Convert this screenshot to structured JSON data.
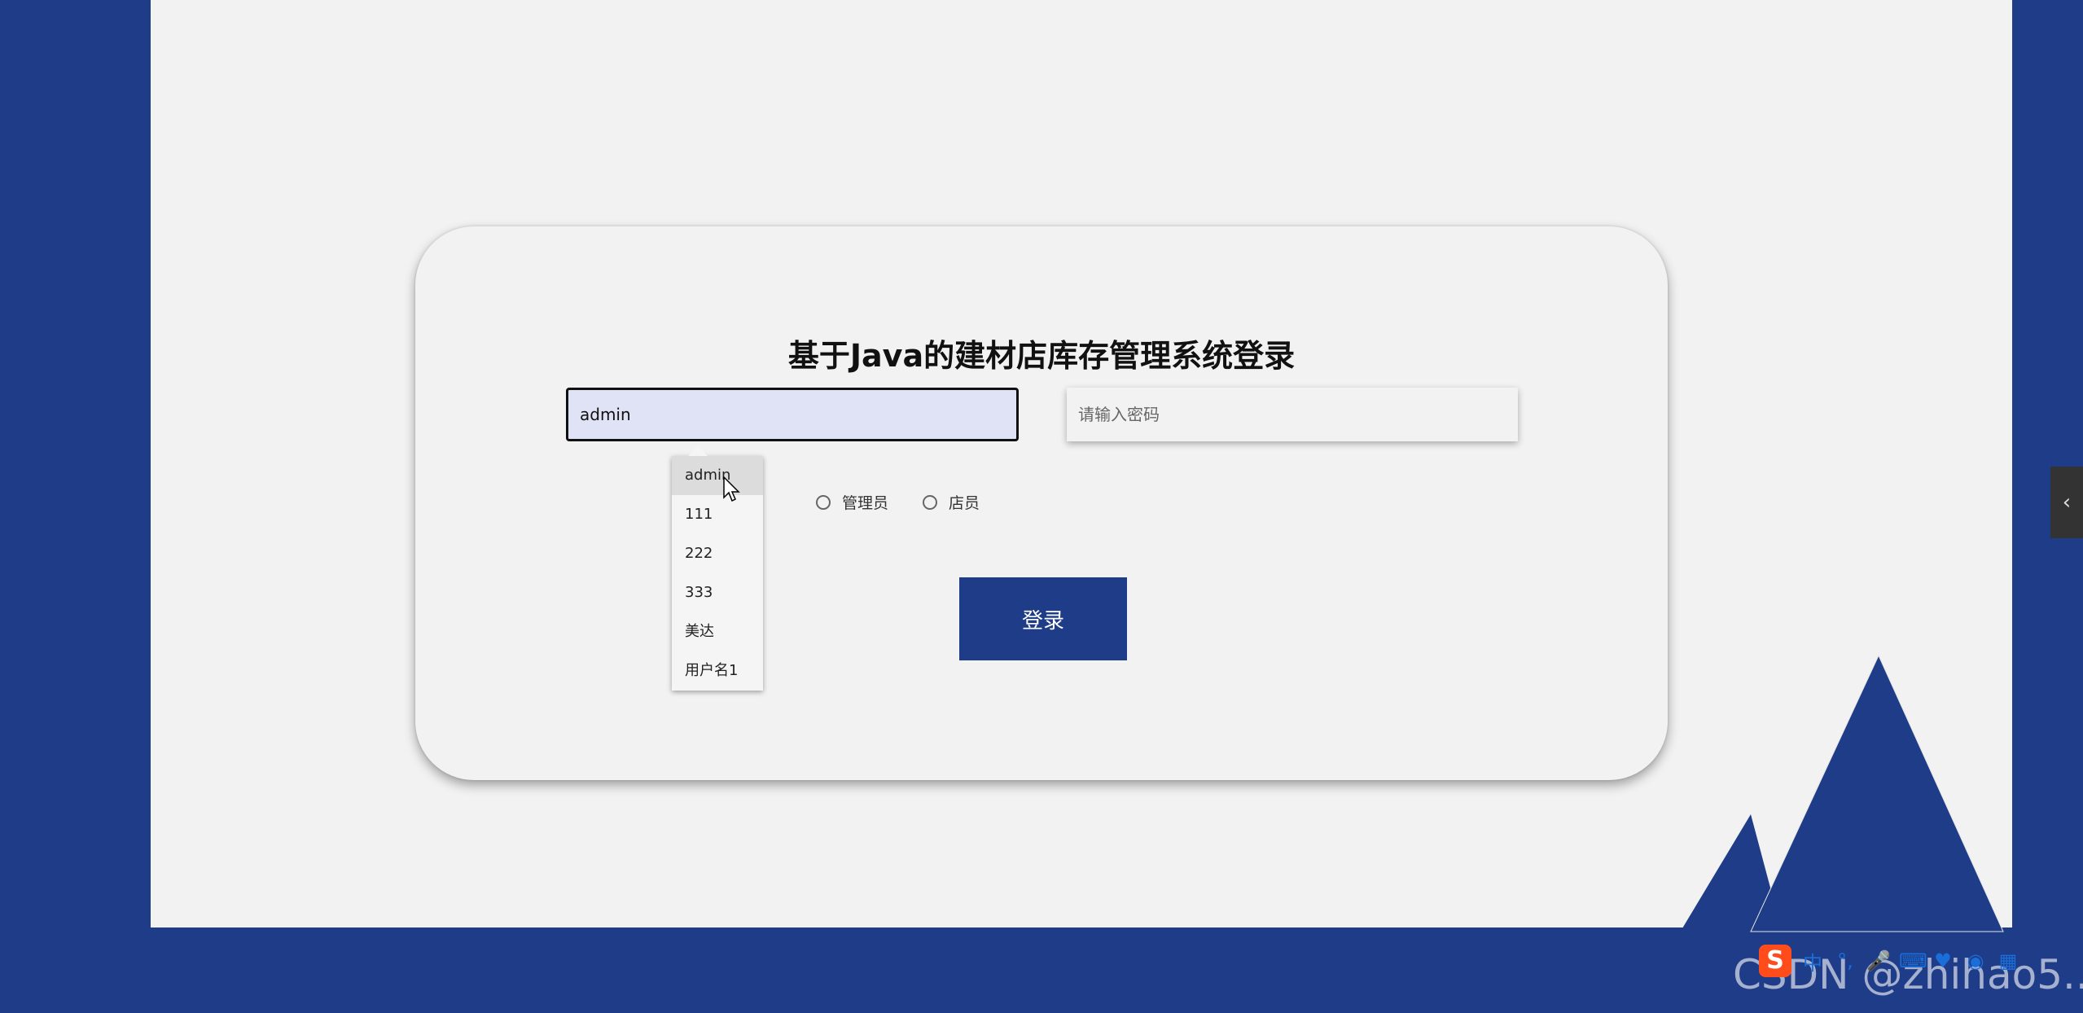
{
  "login": {
    "title": "基于Java的建材店库存管理系统登录",
    "username_value": "admin",
    "password_placeholder": "请输入密码",
    "autocomplete_options": [
      "admin",
      "111",
      "222",
      "333",
      "美达",
      "用户名1"
    ],
    "roles": [
      {
        "label": "管理员"
      },
      {
        "label": "店员"
      }
    ],
    "submit_label": "登录"
  },
  "side_tab": {
    "icon": "chevron-left-icon",
    "glyph": "‹"
  },
  "taskbar": {
    "ime_label": "中",
    "watermark": "CSDN @zhihao5..."
  },
  "colors": {
    "brand": "#1f3c88",
    "panel": "#f2f2f2",
    "input_active": "#dfe3f5"
  }
}
